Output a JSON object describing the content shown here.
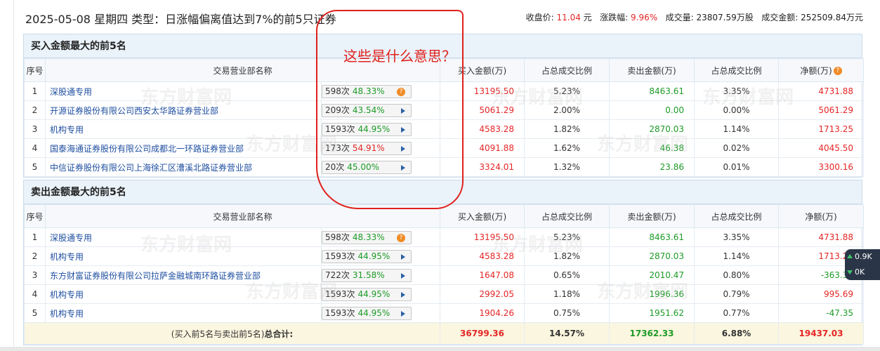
{
  "header": {
    "title": "2025-05-08 星期四 类型：日涨幅偏离值达到7%的前5只证券",
    "close_label": "收盘价:",
    "close_value": "11.04",
    "close_unit": "元",
    "change_label": "涨跌幅:",
    "change_value": "9.96%",
    "volume_label": "成交量:",
    "volume_value": "23807.59万股",
    "turnover_label": "成交金额:",
    "turnover_value": "252509.84万元"
  },
  "annotation_text": "这些是什么意思？",
  "columns": {
    "idx": "序号",
    "name": "交易营业部名称",
    "buy": "买入金额(万)",
    "buy_ratio": "占总成交比例",
    "sell": "卖出金额(万)",
    "sell_ratio": "占总成交比例",
    "net": "净额(万)"
  },
  "buy_section": {
    "title": "买入金额最大的前5名",
    "rows": [
      {
        "idx": "1",
        "name": "深股通专用",
        "count": "598次",
        "pct": "48.33%",
        "pct_color": "green",
        "icon": "question-icon",
        "buy": "13195.50",
        "buy_ratio": "5.23%",
        "sell": "8463.61",
        "sell_ratio": "3.35%",
        "net": "4731.88",
        "net_color": "red"
      },
      {
        "idx": "2",
        "name": "开源证券股份有限公司西安太华路证券营业部",
        "count": "209次",
        "pct": "43.54%",
        "pct_color": "green",
        "icon": "arrow-right-icon",
        "buy": "5061.29",
        "buy_ratio": "2.00%",
        "sell": "0.00",
        "sell_ratio": "0.00%",
        "net": "5061.29",
        "net_color": "red"
      },
      {
        "idx": "3",
        "name": "机构专用",
        "count": "1593次",
        "pct": "44.95%",
        "pct_color": "green",
        "icon": "arrow-right-icon",
        "buy": "4583.28",
        "buy_ratio": "1.82%",
        "sell": "2870.03",
        "sell_ratio": "1.14%",
        "net": "1713.25",
        "net_color": "red"
      },
      {
        "idx": "4",
        "name": "国泰海通证券股份有限公司成都北一环路证券营业部",
        "count": "173次",
        "pct": "54.91%",
        "pct_color": "red",
        "icon": "arrow-right-icon",
        "buy": "4091.88",
        "buy_ratio": "1.62%",
        "sell": "46.38",
        "sell_ratio": "0.02%",
        "net": "4045.50",
        "net_color": "red"
      },
      {
        "idx": "5",
        "name": "中信证券股份有限公司上海徐汇区漕溪北路证券营业部",
        "count": "20次",
        "pct": "45.00%",
        "pct_color": "green",
        "icon": "arrow-right-icon",
        "buy": "3324.01",
        "buy_ratio": "1.32%",
        "sell": "23.86",
        "sell_ratio": "0.01%",
        "net": "3300.16",
        "net_color": "red"
      }
    ]
  },
  "sell_section": {
    "title": "卖出金额最大的前5名",
    "rows": [
      {
        "idx": "1",
        "name": "深股通专用",
        "count": "598次",
        "pct": "48.33%",
        "pct_color": "green",
        "icon": "question-icon",
        "buy": "13195.50",
        "buy_ratio": "5.23%",
        "sell": "8463.61",
        "sell_ratio": "3.35%",
        "net": "4731.88",
        "net_color": "red"
      },
      {
        "idx": "2",
        "name": "机构专用",
        "count": "1593次",
        "pct": "44.95%",
        "pct_color": "green",
        "icon": "arrow-right-icon",
        "buy": "4583.28",
        "buy_ratio": "1.82%",
        "sell": "2870.03",
        "sell_ratio": "1.14%",
        "net": "1713.25",
        "net_color": "red"
      },
      {
        "idx": "3",
        "name": "东方财富证券股份有限公司拉萨金融城南环路证券营业部",
        "count": "722次",
        "pct": "31.58%",
        "pct_color": "green",
        "icon": "arrow-right-icon",
        "buy": "1647.08",
        "buy_ratio": "0.65%",
        "sell": "2010.47",
        "sell_ratio": "0.80%",
        "net": "-363.39",
        "net_color": "green"
      },
      {
        "idx": "4",
        "name": "机构专用",
        "count": "1593次",
        "pct": "44.95%",
        "pct_color": "green",
        "icon": "arrow-right-icon",
        "buy": "2992.05",
        "buy_ratio": "1.18%",
        "sell": "1996.36",
        "sell_ratio": "0.79%",
        "net": "995.69",
        "net_color": "red"
      },
      {
        "idx": "5",
        "name": "机构专用",
        "count": "1593次",
        "pct": "44.95%",
        "pct_color": "green",
        "icon": "arrow-right-icon",
        "buy": "1904.26",
        "buy_ratio": "0.75%",
        "sell": "1951.62",
        "sell_ratio": "0.77%",
        "net": "-47.35",
        "net_color": "green"
      }
    ],
    "total": {
      "label_prefix": "(买入前5名与卖出前5名)",
      "label_bold": "总合计:",
      "buy": "36799.36",
      "buy_ratio": "14.57%",
      "sell": "17362.33",
      "sell_ratio": "6.88%",
      "net": "19437.03"
    }
  },
  "float_widget": {
    "up_value": "0.9",
    "up_unit": "K",
    "down_value": "0",
    "down_unit": "K"
  },
  "watermark": {
    "cn": "东方财富网",
    "en": "eastmoney.com"
  },
  "colors": {
    "red": "#e52626",
    "green": "#1d9a27",
    "link": "#1f4fa0",
    "annotation": "#e0201c"
  }
}
